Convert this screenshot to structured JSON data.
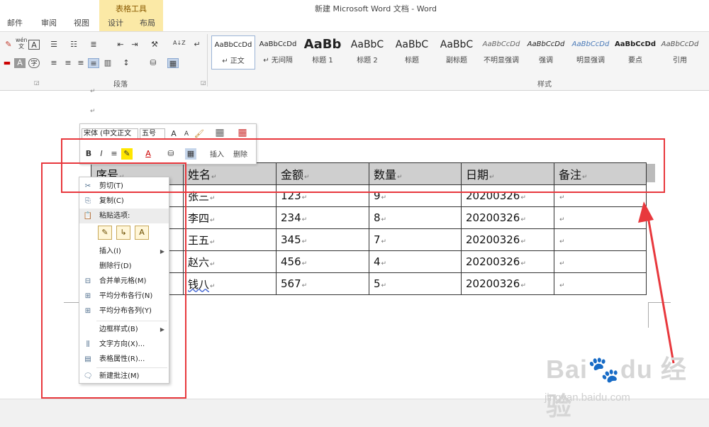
{
  "titlebar": {
    "doc_title": "新建 Microsoft Word 文档 - Word",
    "context_group": "表格工具",
    "tabs": [
      "邮件",
      "审阅",
      "视图",
      "设计",
      "布局"
    ]
  },
  "ribbon": {
    "paragraph_group": "段落",
    "styles_group": "样式",
    "styles": [
      {
        "preview": "AaBbCcDd",
        "name": "↵ 正文"
      },
      {
        "preview": "AaBbCcDd",
        "name": "↵ 无间隔"
      },
      {
        "preview": "AaBb",
        "name": "标题 1"
      },
      {
        "preview": "AaBbC",
        "name": "标题 2"
      },
      {
        "preview": "AaBbC",
        "name": "标题"
      },
      {
        "preview": "AaBbC",
        "name": "副标题"
      },
      {
        "preview": "AaBbCcDd",
        "name": "不明显强调"
      },
      {
        "preview": "AaBbCcDd",
        "name": "强调"
      },
      {
        "preview": "AaBbCcDd",
        "name": "明显强调"
      },
      {
        "preview": "AaBbCcDd",
        "name": "要点"
      },
      {
        "preview": "AaBbCcDd",
        "name": "引用"
      }
    ],
    "icons": {
      "wen": "wén\n文",
      "sort": "A↓Z",
      "a_box": "A",
      "zi": "字"
    }
  },
  "mini_toolbar": {
    "font": "宋体 (中文正文",
    "size": "五号",
    "insert_label": "插入",
    "delete_label": "删除",
    "grow": "A",
    "shrink": "A",
    "bold": "B",
    "italic": "I",
    "font_color": "A"
  },
  "table": {
    "headers": [
      "序号",
      "姓名",
      "金额",
      "数量",
      "日期",
      "备注"
    ],
    "rows": [
      [
        "",
        "张三",
        "123",
        "9",
        "20200326",
        ""
      ],
      [
        "",
        "李四",
        "234",
        "8",
        "20200326",
        ""
      ],
      [
        "",
        "王五",
        "345",
        "7",
        "20200326",
        ""
      ],
      [
        "",
        "赵六",
        "456",
        "4",
        "20200326",
        ""
      ],
      [
        "",
        "钱八",
        "567",
        "5",
        "20200326",
        ""
      ]
    ],
    "cell_mark": "↵"
  },
  "context_menu": {
    "cut": "剪切(T)",
    "copy": "复制(C)",
    "paste_options": "粘贴选项:",
    "insert": "插入(I)",
    "delete_row": "删除行(D)",
    "merge_cells": "合并单元格(M)",
    "distribute_rows": "平均分布各行(N)",
    "distribute_cols": "平均分布各列(Y)",
    "border_style": "边框样式(B)",
    "text_direction": "文字方向(X)...",
    "table_properties": "表格属性(R)...",
    "new_comment": "新建批注(M)"
  },
  "watermark": {
    "text": "Bai🐾du 经验",
    "url": "jingyan.baidu.com"
  },
  "colors": {
    "accent_red": "#e8383d",
    "header_gray": "#cfcfcf",
    "context_tab": "#fbe9a6"
  }
}
